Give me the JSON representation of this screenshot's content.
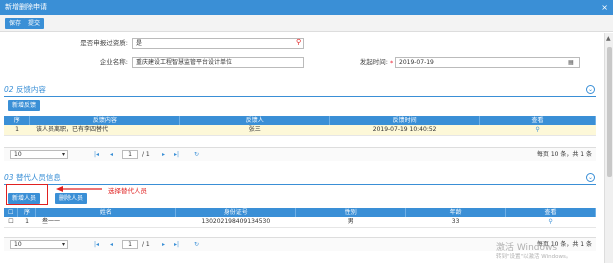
{
  "window": {
    "title": "新增删除申请",
    "close": "×"
  },
  "toolbar": {
    "save": "保存",
    "submit": "提交"
  },
  "form": {
    "is_deleted_label": "是否申报过资质:",
    "is_deleted_value": "是",
    "company_label": "企业名称:",
    "company_value": "重庆建设工程智慧监管平台设计单位",
    "date_label": "发起时间:",
    "date_value": "2019-07-19"
  },
  "section1": {
    "num": "02",
    "title": "反馈内容",
    "add_button": "新增反馈",
    "headers": [
      "序",
      "反馈内容",
      "反馈人",
      "反馈时间",
      "查看"
    ],
    "rows": [
      {
        "no": "1",
        "content": "该人员离职，已有李四替代",
        "person": "张三",
        "time": "2019-07-19 10:40:52"
      }
    ]
  },
  "pager1": {
    "size": "10",
    "page": "1",
    "total_pages": "/ 1",
    "summary": "每页 10 条，共 1 条"
  },
  "section2": {
    "num": "03",
    "title": "替代人员信息",
    "add_button": "新增人员",
    "delete_button": "删除人员",
    "annotation": "选择替代人员",
    "headers": [
      "序",
      "姓名",
      "身份证号",
      "性别",
      "年龄",
      "查看"
    ],
    "rows": [
      {
        "no": "1",
        "name": "叁一一",
        "id": "130202198409134530",
        "gender": "男",
        "age": "33"
      }
    ]
  },
  "pager2": {
    "size": "10",
    "page": "1",
    "total_pages": "/ 1",
    "summary": "每页 10 条，共 1 条"
  },
  "watermark": {
    "line1": "激活 Windows",
    "line2": "转到\"设置\"以激活 Windows。"
  },
  "colors": {
    "primary": "#3a8fd6",
    "annotation": "#e02020"
  }
}
